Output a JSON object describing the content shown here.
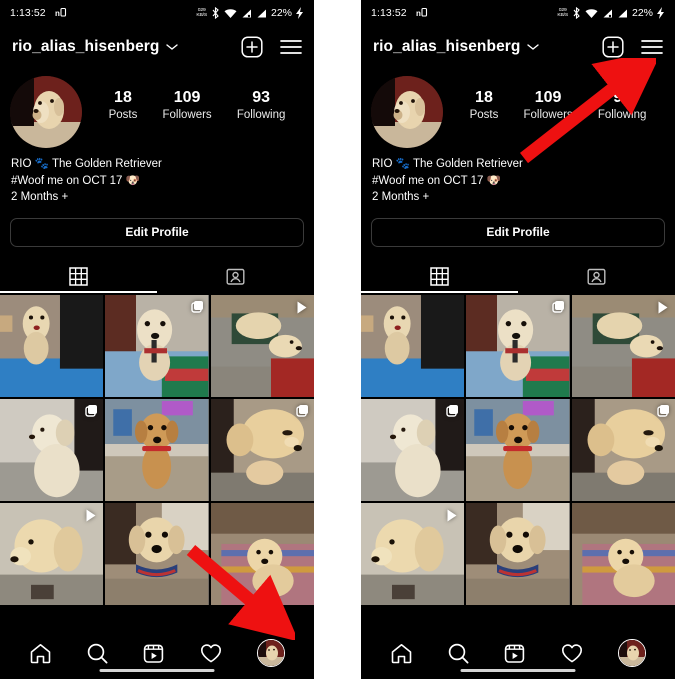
{
  "app": {
    "name": "Instagram",
    "theme": "dark",
    "background": "#000000",
    "accent": "#ffffff"
  },
  "status_bar": {
    "time": "1:13:52",
    "data_rate_top": "029",
    "data_rate_bottom": "KB/S",
    "battery": "22%",
    "icons": [
      "nb-icon",
      "bluetooth-icon",
      "wifi-icon",
      "signal-1-icon",
      "signal-2-icon",
      "charging-bolt-icon"
    ]
  },
  "header": {
    "username": "rio_alias_hisenberg",
    "chevron": "⌄",
    "create_label": "+",
    "actions": [
      "create-post-icon",
      "menu-icon"
    ]
  },
  "profile": {
    "avatar_name": "profile-avatar",
    "stats": [
      {
        "count": "18",
        "label": "Posts"
      },
      {
        "count": "109",
        "label": "Followers"
      },
      {
        "count": "93",
        "label": "Following"
      }
    ],
    "bio": {
      "line1": "RIO 🐾 The Golden Retriever",
      "line2": "#Woof me on OCT 17 🐶",
      "line3": "2 Months +"
    },
    "edit_profile_label": "Edit Profile"
  },
  "tabs": [
    {
      "name": "grid-tab",
      "icon": "grid-icon",
      "active": true
    },
    {
      "name": "tagged-tab",
      "icon": "tagged-person-icon",
      "active": false
    }
  ],
  "grid": {
    "cells": [
      {
        "id": 1,
        "badge": "none",
        "alt": "dog-on-blue-table"
      },
      {
        "id": 2,
        "badge": "carousel",
        "alt": "puppy-with-remote-on-bed"
      },
      {
        "id": 3,
        "badge": "video",
        "alt": "dog-lying-with-bag"
      },
      {
        "id": 4,
        "badge": "carousel",
        "alt": "white-puppy-by-wall"
      },
      {
        "id": 5,
        "badge": "none",
        "alt": "puppy-with-red-collar"
      },
      {
        "id": 6,
        "badge": "carousel",
        "alt": "golden-dog-resting"
      },
      {
        "id": 7,
        "badge": "video",
        "alt": "puppy-closeup-side"
      },
      {
        "id": 8,
        "badge": "none",
        "alt": "puppy-with-blue-harness"
      },
      {
        "id": 9,
        "badge": "none",
        "alt": "puppy-on-carpet"
      }
    ]
  },
  "bottom_nav": {
    "items": [
      {
        "name": "nav-home",
        "icon": "home-icon",
        "active": false
      },
      {
        "name": "nav-search",
        "icon": "search-icon",
        "active": false
      },
      {
        "name": "nav-reels",
        "icon": "reels-icon",
        "active": false
      },
      {
        "name": "nav-likes",
        "icon": "heart-icon",
        "active": false
      },
      {
        "name": "nav-profile",
        "icon": "avatar-icon",
        "active": true
      }
    ]
  },
  "annotations": {
    "color": "#ee1111",
    "left_arrow": {
      "points_to": "nav-profile",
      "direction": "down-right"
    },
    "right_arrow": {
      "points_to": "menu-icon",
      "direction": "up-right"
    }
  }
}
